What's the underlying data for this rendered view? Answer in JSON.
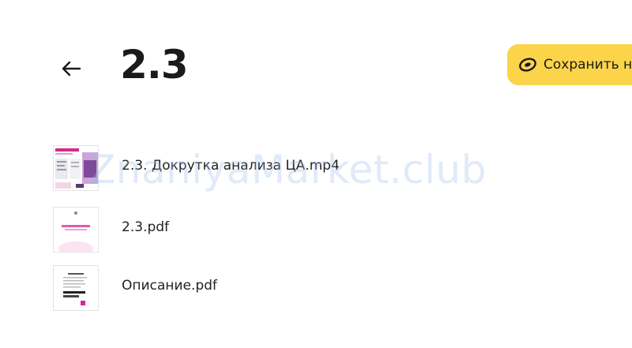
{
  "header": {
    "title": "2.3",
    "save_label": "Сохранить н"
  },
  "files": [
    {
      "name": "2.3. Докрутка анализа ЦА.mp4",
      "thumb_icon": "video-thumbnail"
    },
    {
      "name": "2.3.pdf",
      "thumb_icon": "pdf-thumbnail"
    },
    {
      "name": "Описание.pdf",
      "thumb_icon": "pdf-thumbnail"
    }
  ],
  "watermark": "ZnaniyaMarket.club",
  "colors": {
    "accent_yellow": "#fbd44a",
    "text": "#1a1a1a",
    "brand_pink": "#d12b8f"
  }
}
